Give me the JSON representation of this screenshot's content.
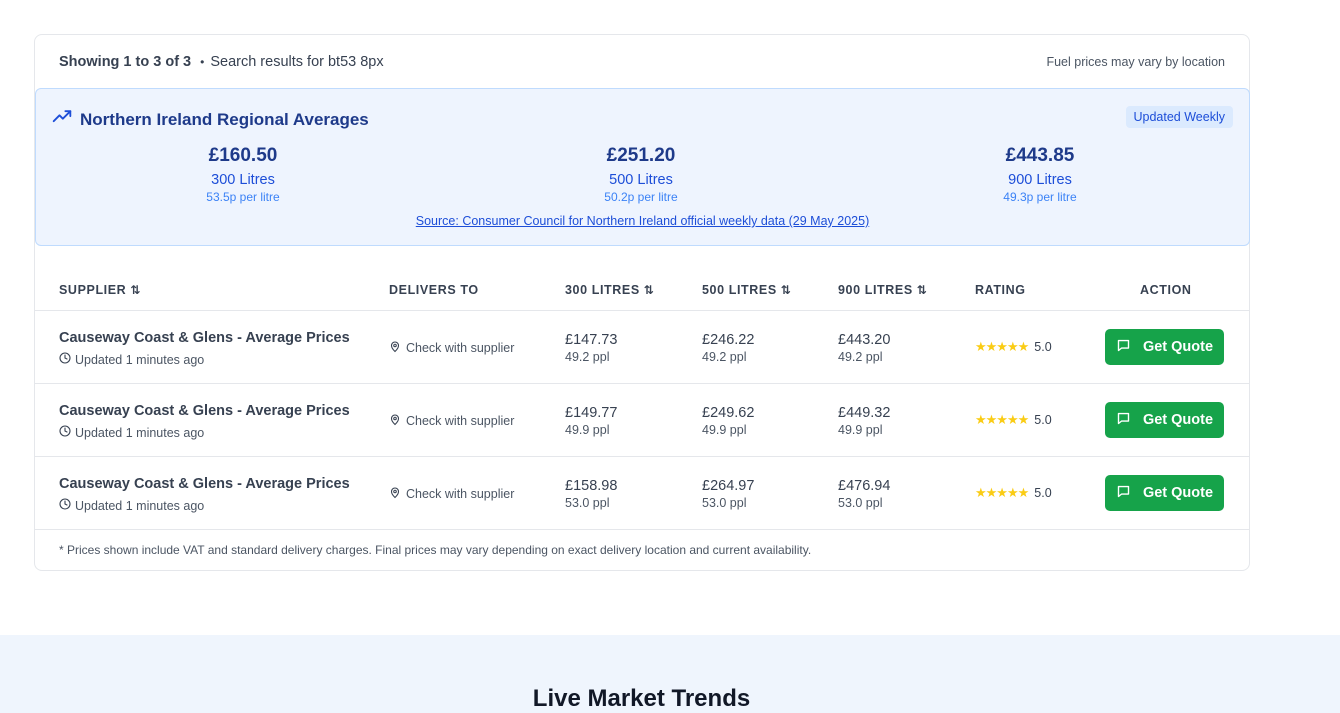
{
  "results": {
    "count_text": "Showing 1 to 3 of 3",
    "bullet": "•",
    "search_text": "Search results for bt53 8px",
    "notice": "Fuel prices may vary by location"
  },
  "regional": {
    "title": "Northern Ireland Regional Averages",
    "badge": "Updated Weekly",
    "averages": [
      {
        "price": "£160.50",
        "litres": "300 Litres",
        "ppl": "53.5p per litre"
      },
      {
        "price": "£251.20",
        "litres": "500 Litres",
        "ppl": "50.2p per litre"
      },
      {
        "price": "£443.85",
        "litres": "900 Litres",
        "ppl": "49.3p per litre"
      }
    ],
    "source": "Source: Consumer Council for Northern Ireland official weekly data (29 May 2025)"
  },
  "table": {
    "headers": {
      "supplier": "SUPPLIER",
      "delivers": "DELIVERS TO",
      "l300": "300 LITRES",
      "l500": "500 LITRES",
      "l900": "900 LITRES",
      "rating": "RATING",
      "action": "ACTION"
    },
    "sort_glyph": "⇅",
    "rows": [
      {
        "supplier": "Causeway Coast & Glens - Average Prices",
        "updated": "Updated 1 minutes ago",
        "delivers": "Check with supplier",
        "p300": "£147.73",
        "ppl300": "49.2 ppl",
        "p500": "£246.22",
        "ppl500": "49.2 ppl",
        "p900": "£443.20",
        "ppl900": "49.2 ppl",
        "stars": "★★★★★",
        "rating": "5.0",
        "button": "Get Quote"
      },
      {
        "supplier": "Causeway Coast & Glens - Average Prices",
        "updated": "Updated 1 minutes ago",
        "delivers": "Check with supplier",
        "p300": "£149.77",
        "ppl300": "49.9 ppl",
        "p500": "£249.62",
        "ppl500": "49.9 ppl",
        "p900": "£449.32",
        "ppl900": "49.9 ppl",
        "stars": "★★★★★",
        "rating": "5.0",
        "button": "Get Quote"
      },
      {
        "supplier": "Causeway Coast & Glens - Average Prices",
        "updated": "Updated 1 minutes ago",
        "delivers": "Check with supplier",
        "p300": "£158.98",
        "ppl300": "53.0 ppl",
        "p500": "£264.97",
        "ppl500": "53.0 ppl",
        "p900": "£476.94",
        "ppl900": "53.0 ppl",
        "stars": "★★★★★",
        "rating": "5.0",
        "button": "Get Quote"
      }
    ],
    "footnote": "* Prices shown include VAT and standard delivery charges. Final prices may vary depending on exact delivery location and current availability."
  },
  "trends": {
    "title": "Live Market Trends"
  },
  "colors": {
    "brand_blue": "#1e3a8a",
    "link_blue": "#1d4ed8",
    "button_green": "#16a34a",
    "star_yellow": "#facc15"
  }
}
